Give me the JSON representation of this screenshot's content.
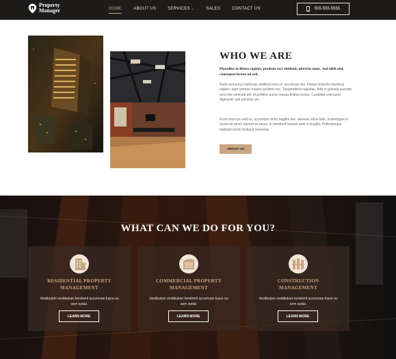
{
  "header": {
    "logo_line1": "Property",
    "logo_line2": "Manager",
    "nav": [
      "HOME",
      "ABOUT US",
      "SERVICES",
      "SALES",
      "CONTACT US"
    ],
    "phone": "555-555-5555"
  },
  "about": {
    "title": "WHO WE ARE",
    "lead": "Phasellus in libero sagittis, pretium orci eleifend, ultricies nunc. Sed nibh nisl, consequat luctus mi sed.",
    "p1": "Nulla sed purus vehicula, eleifend eros et, accumsan leo. Integer lobortis maximus sapien, eget semper mauris porttitor nec. Suspendisse egestas, felis in gravida suscipit, arcu nisi vehicula elit, id porttitor purus massa finibus lectus. Curabitur erat justo, dignissim sed pulvinar vel.",
    "p2": "Proin rhoncus velit mi, ut pretium dolor sagittis nec. Aenean tellus felis, scelerisque in luctus sit amet, laoreet ac lacus. In hendrerit laoreet ante a fringilla. Pellentesque habitant morbi tristique senectus.",
    "button": "ABOUT US"
  },
  "services": {
    "title": "WHAT CAN WE DO FOR YOU?",
    "cards": [
      {
        "title_line1": "RESIDENTIAL PROPERTY",
        "title_line2": "MANAGEMENT",
        "text": "Vestibulum vestibulum hendrerit accumsan fusce eu sem sodal.",
        "button": "LEARN MORE"
      },
      {
        "title_line1": "COMMERCIAL PROPERTY",
        "title_line2": "MANAGEMENT",
        "text": "Vestibulum vestibulum hendrerit accumsan fusce eu sem sodal.",
        "button": "LEARN MORE"
      },
      {
        "title_line1": "CONSTRUCTION",
        "title_line2": "MANAGEMENT",
        "text": "Vestibulum vestibulum hendrerit accumsan fusce eu sem sodal.",
        "button": "LEARN MORE"
      }
    ]
  },
  "colors": {
    "header_bg": "#1e1c1b",
    "accent": "#c9a582",
    "card_bg": "#3a2a22"
  }
}
